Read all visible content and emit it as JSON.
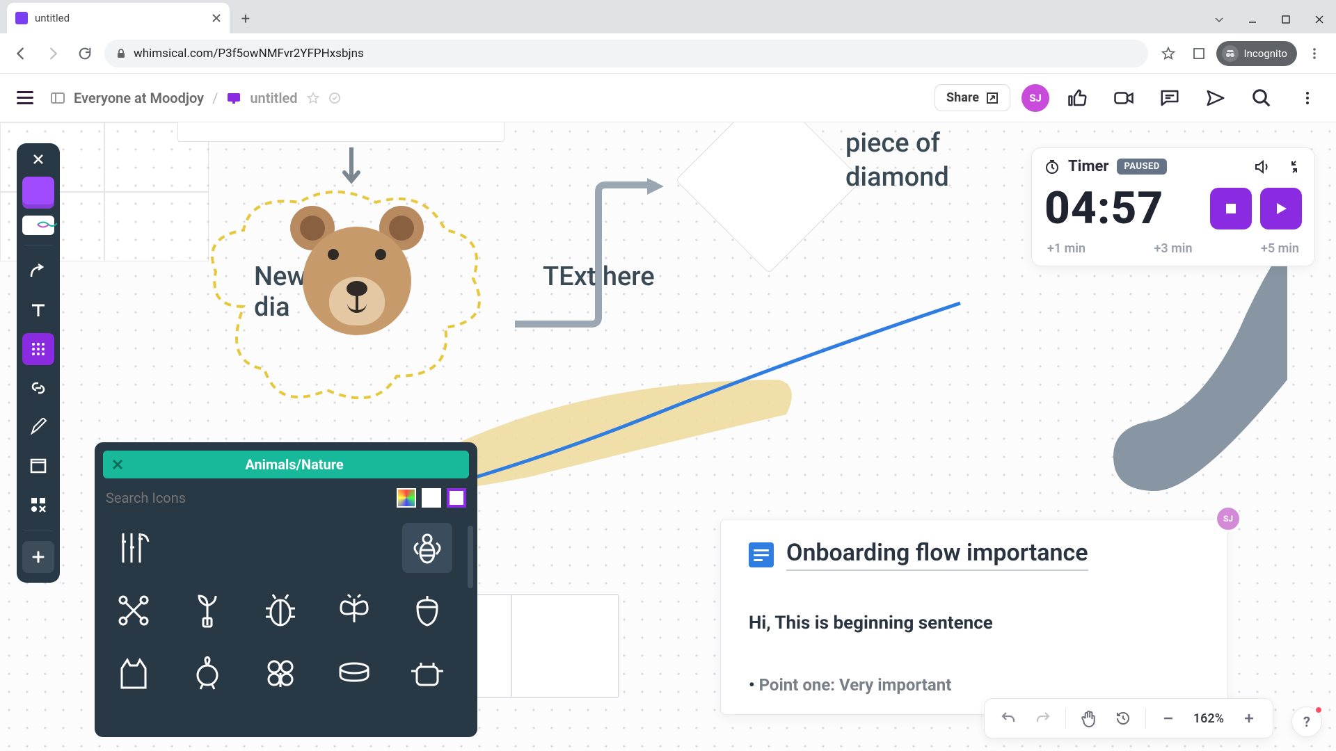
{
  "browser": {
    "tab_title": "untitled",
    "url": "whimsical.com/P3f5owNMFvr2YFPHxsbjns",
    "incognito_label": "Incognito"
  },
  "header": {
    "workspace": "Everyone at Moodjoy",
    "doc_title": "untitled",
    "share_label": "Share",
    "avatar_initials": "SJ"
  },
  "canvas": {
    "text_new": "New\ndia",
    "text_here": "TExt here",
    "text_piece": "piece of\ndiamond"
  },
  "timer": {
    "title": "Timer",
    "badge": "PAUSED",
    "time": "04:57",
    "add1": "+1 min",
    "add3": "+3 min",
    "add5": "+5 min"
  },
  "picker": {
    "title": "Animals/Nature",
    "placeholder": "Search Icons"
  },
  "doc": {
    "title": "Onboarding flow importance",
    "sentence": "Hi, This is beginning sentence",
    "bullet1": "Point one: Very important",
    "avatar": "SJ"
  },
  "bottombar": {
    "zoom": "162%"
  }
}
